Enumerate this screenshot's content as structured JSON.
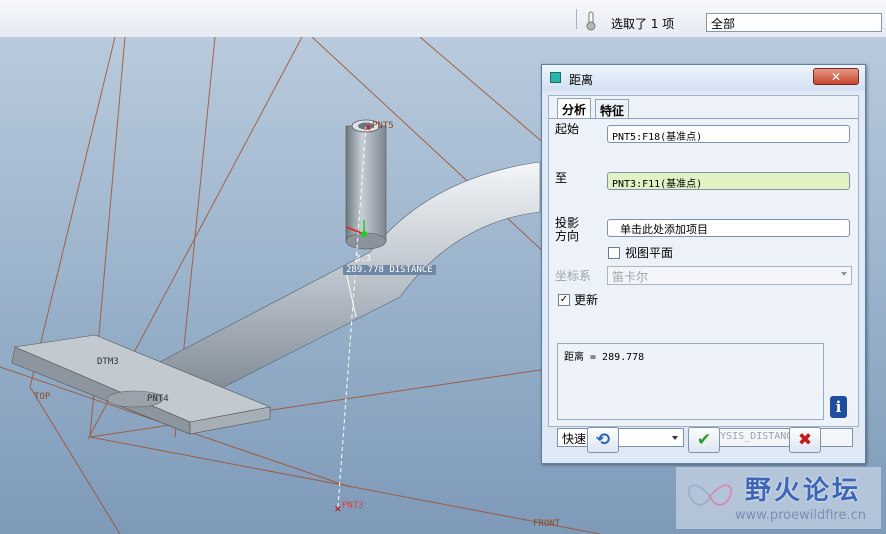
{
  "toolbar": {
    "selection_status": "选取了 1 项",
    "filter_value": "全部"
  },
  "viewport": {
    "labels": {
      "pnt5": "PNT5",
      "pnt3": "PNT3",
      "pnt4": "PNT4",
      "dtm3": "DTM3",
      "top": "TOP",
      "front": "FRONT",
      "point_number": "3.3",
      "distance": "289.778  DISTANCE"
    }
  },
  "dialog": {
    "title": "距离",
    "close_label": "✕",
    "tabs": [
      "分析",
      "特征"
    ],
    "from_label": "起始",
    "from_value": "PNT5:F18(基准点)",
    "to_label": "至",
    "to_value": "PNT3:F11(基准点)",
    "projection_label_1": "投影",
    "projection_label_2": "方向",
    "projection_value": "单击此处添加项目",
    "view_plane_label": "视图平面",
    "csys_label": "坐标系",
    "csys_value": "笛卡尔",
    "update_label": "更新",
    "result_text": "距离 = 289.778",
    "info_label": "i",
    "speed_value": "快速",
    "analysis_name": "ANALYSIS_DISTANCE_1",
    "buttons": {
      "repeat": "⟲",
      "ok": "✔",
      "cancel": "✖"
    }
  },
  "watermark": {
    "title": "野火论坛",
    "url": "www.proewildfire.cn"
  },
  "colors": {
    "accent_green": "#2e9b2e",
    "cancel_red": "#c41a1a",
    "highlight_field": "#e1f3c4"
  }
}
